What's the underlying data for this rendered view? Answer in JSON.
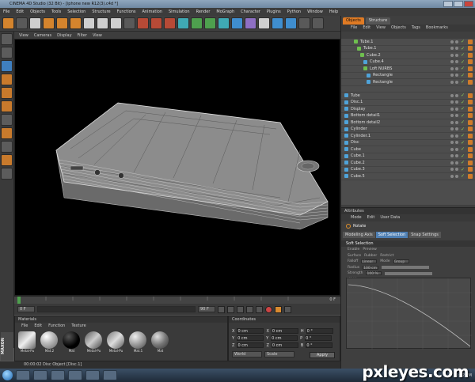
{
  "window": {
    "title": "CINEMA 4D Studio (32 Bit) - [iphone new R12(3).c4d *]"
  },
  "menubar": [
    "File",
    "Edit",
    "Objects",
    "Tools",
    "Selection",
    "Structure",
    "Functions",
    "Animation",
    "Simulation",
    "Render",
    "MoGraph",
    "Character",
    "Plugins",
    "Python",
    "Window",
    "Help"
  ],
  "viewport": {
    "menu": [
      "View",
      "Cameras",
      "Display",
      "Filter",
      "View"
    ]
  },
  "timeline": {
    "start_frame": "0 F",
    "end_frame": "90 F",
    "current": "0 F",
    "end_label": "0 F"
  },
  "materials": {
    "title": "Materials",
    "menu": [
      "File",
      "Edit",
      "Function",
      "Texture"
    ],
    "items": [
      "Metal-Pu",
      "Mat.2",
      "Mat",
      "Metal-Pu",
      "Metal-Pu",
      "Mat.1",
      "Mat"
    ]
  },
  "coordinates": {
    "title": "Coordinates",
    "rows": [
      [
        "X",
        "0 cm",
        "X",
        "0 cm",
        "H",
        "0 °"
      ],
      [
        "Y",
        "0 cm",
        "Y",
        "0 cm",
        "P",
        "0 °"
      ],
      [
        "Z",
        "0 cm",
        "Z",
        "0 cm",
        "B",
        "0 °"
      ]
    ],
    "mode_left": "World",
    "mode_mid": "Scale",
    "apply": "Apply"
  },
  "status": {
    "text": "00:00:02   Disc Object [Disc.1]"
  },
  "right_panel": {
    "tabs": [
      "Objects",
      "Structure"
    ],
    "menu": [
      "File",
      "Edit",
      "View",
      "Objects",
      "Tags",
      "Bookmarks"
    ],
    "objects": [
      {
        "name": "Tube.1",
        "indent": 8,
        "ico": "g"
      },
      {
        "name": "Tube.1",
        "indent": 10,
        "ico": "g"
      },
      {
        "name": "Cube.2",
        "indent": 12,
        "ico": "g"
      },
      {
        "name": "Cube.4",
        "indent": 14,
        "ico": "b"
      },
      {
        "name": "Loft NURBS",
        "indent": 14,
        "ico": "g"
      },
      {
        "name": "Rectangle",
        "indent": 16,
        "ico": "b"
      },
      {
        "name": "Rectangle",
        "indent": 16,
        "ico": "b"
      },
      {
        "name": "",
        "indent": 2,
        "ico": "none"
      },
      {
        "name": "Tube",
        "indent": 2,
        "ico": "b"
      },
      {
        "name": "Disc.1",
        "indent": 2,
        "ico": "b"
      },
      {
        "name": "Display",
        "indent": 2,
        "ico": "b"
      },
      {
        "name": "Bottom detail1",
        "indent": 2,
        "ico": "b"
      },
      {
        "name": "Bottom detail2",
        "indent": 2,
        "ico": "b"
      },
      {
        "name": "Cylinder",
        "indent": 2,
        "ico": "b"
      },
      {
        "name": "Cylinder.1",
        "indent": 2,
        "ico": "b"
      },
      {
        "name": "Disc",
        "indent": 2,
        "ico": "b"
      },
      {
        "name": "Cube",
        "indent": 2,
        "ico": "b"
      },
      {
        "name": "Cube.1",
        "indent": 2,
        "ico": "b"
      },
      {
        "name": "Cube.2",
        "indent": 2,
        "ico": "b"
      },
      {
        "name": "Cube.3",
        "indent": 2,
        "ico": "b"
      },
      {
        "name": "Cube.5",
        "indent": 2,
        "ico": "b"
      }
    ]
  },
  "attributes": {
    "title": "Attributes",
    "menu": [
      "Mode",
      "Edit",
      "User Data"
    ],
    "tool": "Rotate",
    "tabs": [
      "Modeling Axis",
      "Soft Selection",
      "Snap Settings"
    ],
    "section": "Soft Selection",
    "rows": [
      [
        "Enable",
        "Preview"
      ],
      [
        "Surface",
        "Rubber",
        "Restrict"
      ],
      [
        "Falloff",
        "Linear",
        "Mode",
        "Group"
      ],
      [
        "Radius",
        "100 cm"
      ],
      [
        "Strength",
        "100 %"
      ],
      [
        "Width",
        "50 %"
      ]
    ]
  },
  "taskbar": {
    "clock": "11:42 PM"
  },
  "watermark": "pxleyes.com"
}
